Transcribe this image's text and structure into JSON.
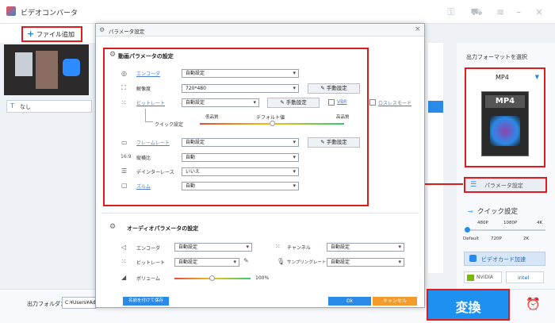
{
  "app": {
    "title": "ビデオコンバータ"
  },
  "toolbar": {
    "add_file": "ファイル追加"
  },
  "subtitle": {
    "value": "なし"
  },
  "right": {
    "format_title": "出力フォーマットを選択",
    "format": "MP4",
    "format_badge": "MP4",
    "param_button": "パラメータ設定",
    "quick_title": "クイック設定",
    "ticks_top": [
      "480P",
      "1080P",
      "4K"
    ],
    "ticks_bottom": [
      "Default",
      "720P",
      "2K"
    ],
    "gpu_button": "ビデオカード加速",
    "gpu1": "NVIDIA",
    "gpu2": "intel"
  },
  "bottom": {
    "output_folder_label": "出力フォルダ：",
    "output_folder_value": "C:¥Users¥Ad",
    "convert_button": "変換"
  },
  "dialog": {
    "title": "パラメータ設定",
    "video_section": "動画パラメータの設定",
    "video_rows": [
      {
        "label": "エンコーダ",
        "value": "自動設定"
      },
      {
        "label": "解像度",
        "value": "720*480"
      },
      {
        "label": "ビットレート",
        "value": "自動設定"
      },
      {
        "label": "フレームレート",
        "value": "自動設定"
      },
      {
        "label": "縦横比",
        "value": "自動"
      },
      {
        "label": "デインターレース",
        "value": "いいえ"
      },
      {
        "label": "ズルム",
        "value": "自動"
      }
    ],
    "manual": "手動設定",
    "vbr": "VBR",
    "lossless": "ロスレスモード",
    "quick_label": "クイック設定",
    "low_quality": "低品質",
    "default_value": "デフォルト値",
    "high_quality": "高品質",
    "audio_section": "オーディオパラメータの設定",
    "audio": {
      "encoder_label": "エンコーダ",
      "encoder_value": "自動設定",
      "channel_label": "チャンネル",
      "channel_value": "自動設定",
      "bitrate_label": "ビットレート",
      "bitrate_value": "自動設定",
      "sample_label": "サンプリングレート",
      "sample_value": "自動設定",
      "volume_label": "ボリューム",
      "volume_value": "100%"
    },
    "save_name": "名前を付けて保存",
    "ok": "Ok",
    "cancel": "キャンセル"
  },
  "colors": {
    "accent": "#1a8be8",
    "red": "#e01b1b",
    "orange": "#f39c2b",
    "blue_btn": "#2a8ae8"
  }
}
